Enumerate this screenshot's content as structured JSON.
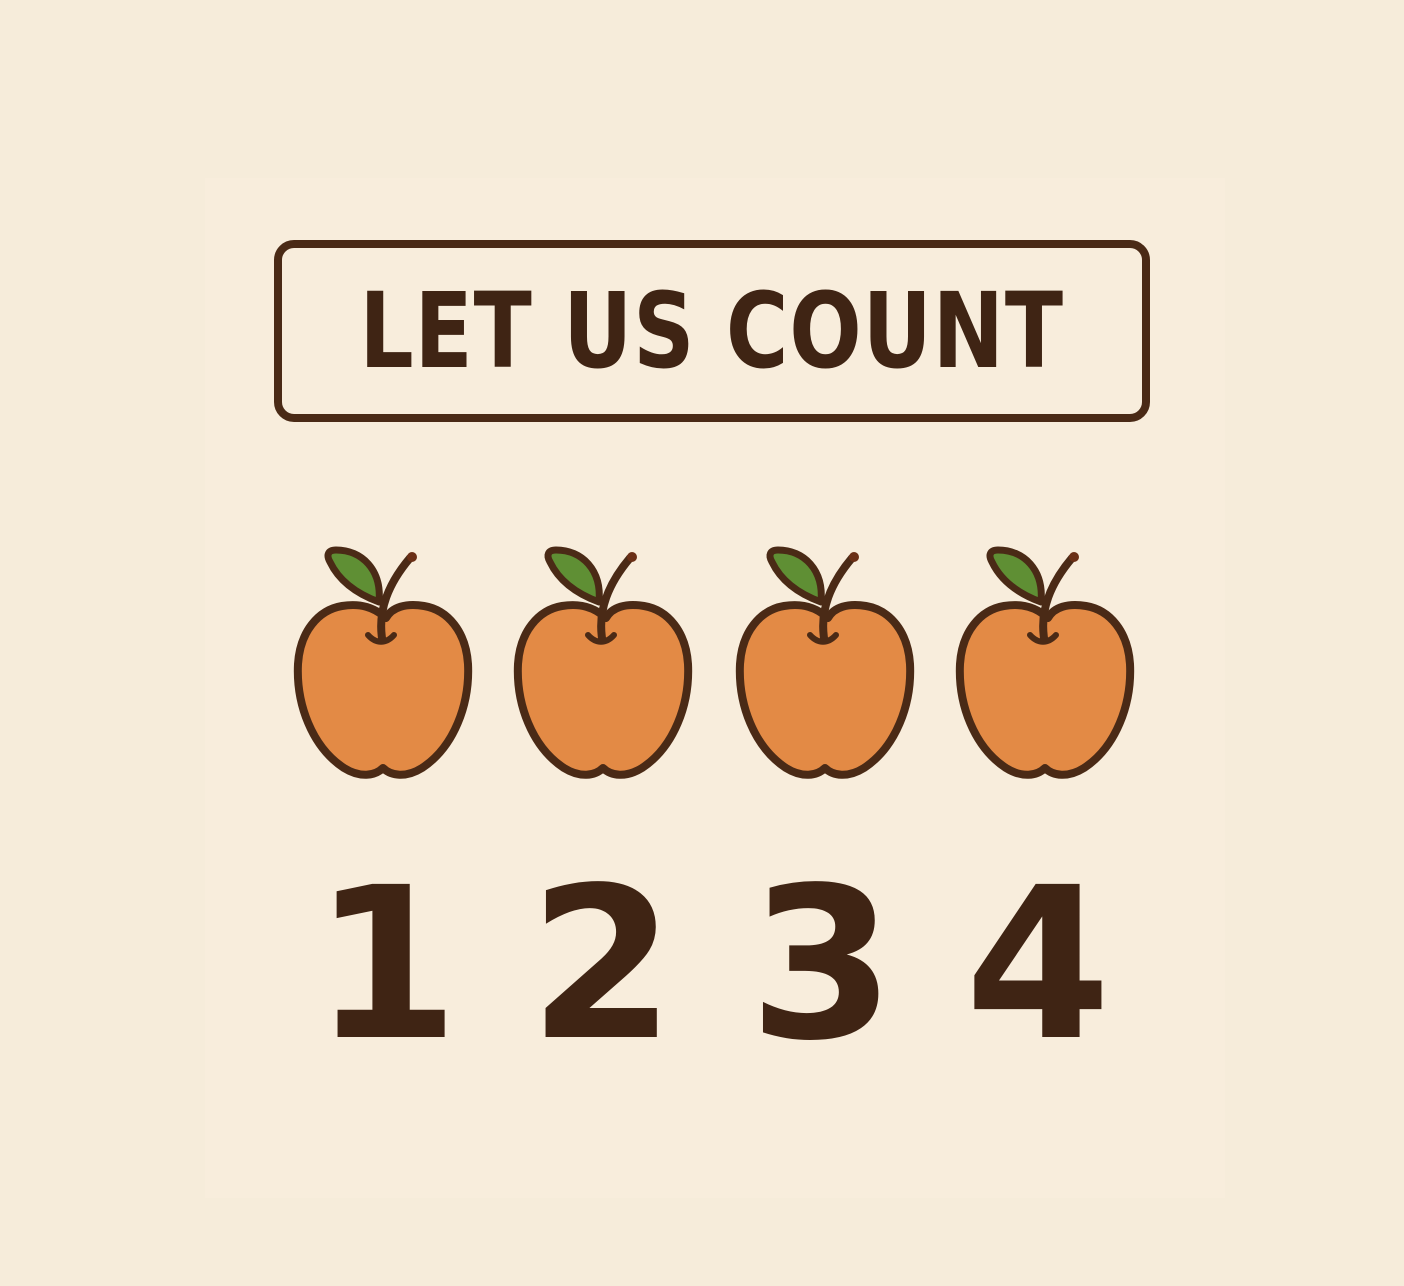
{
  "title": "LET US COUNT",
  "apples": [
    {
      "icon": "apple-icon"
    },
    {
      "icon": "apple-icon"
    },
    {
      "icon": "apple-icon"
    },
    {
      "icon": "apple-icon"
    }
  ],
  "numbers": [
    "1",
    "2",
    "3",
    "4"
  ],
  "colors": {
    "background": "#f6ecda",
    "outline": "#4a2a16",
    "apple": "#e38a45",
    "leaf": "#5f8f34"
  }
}
